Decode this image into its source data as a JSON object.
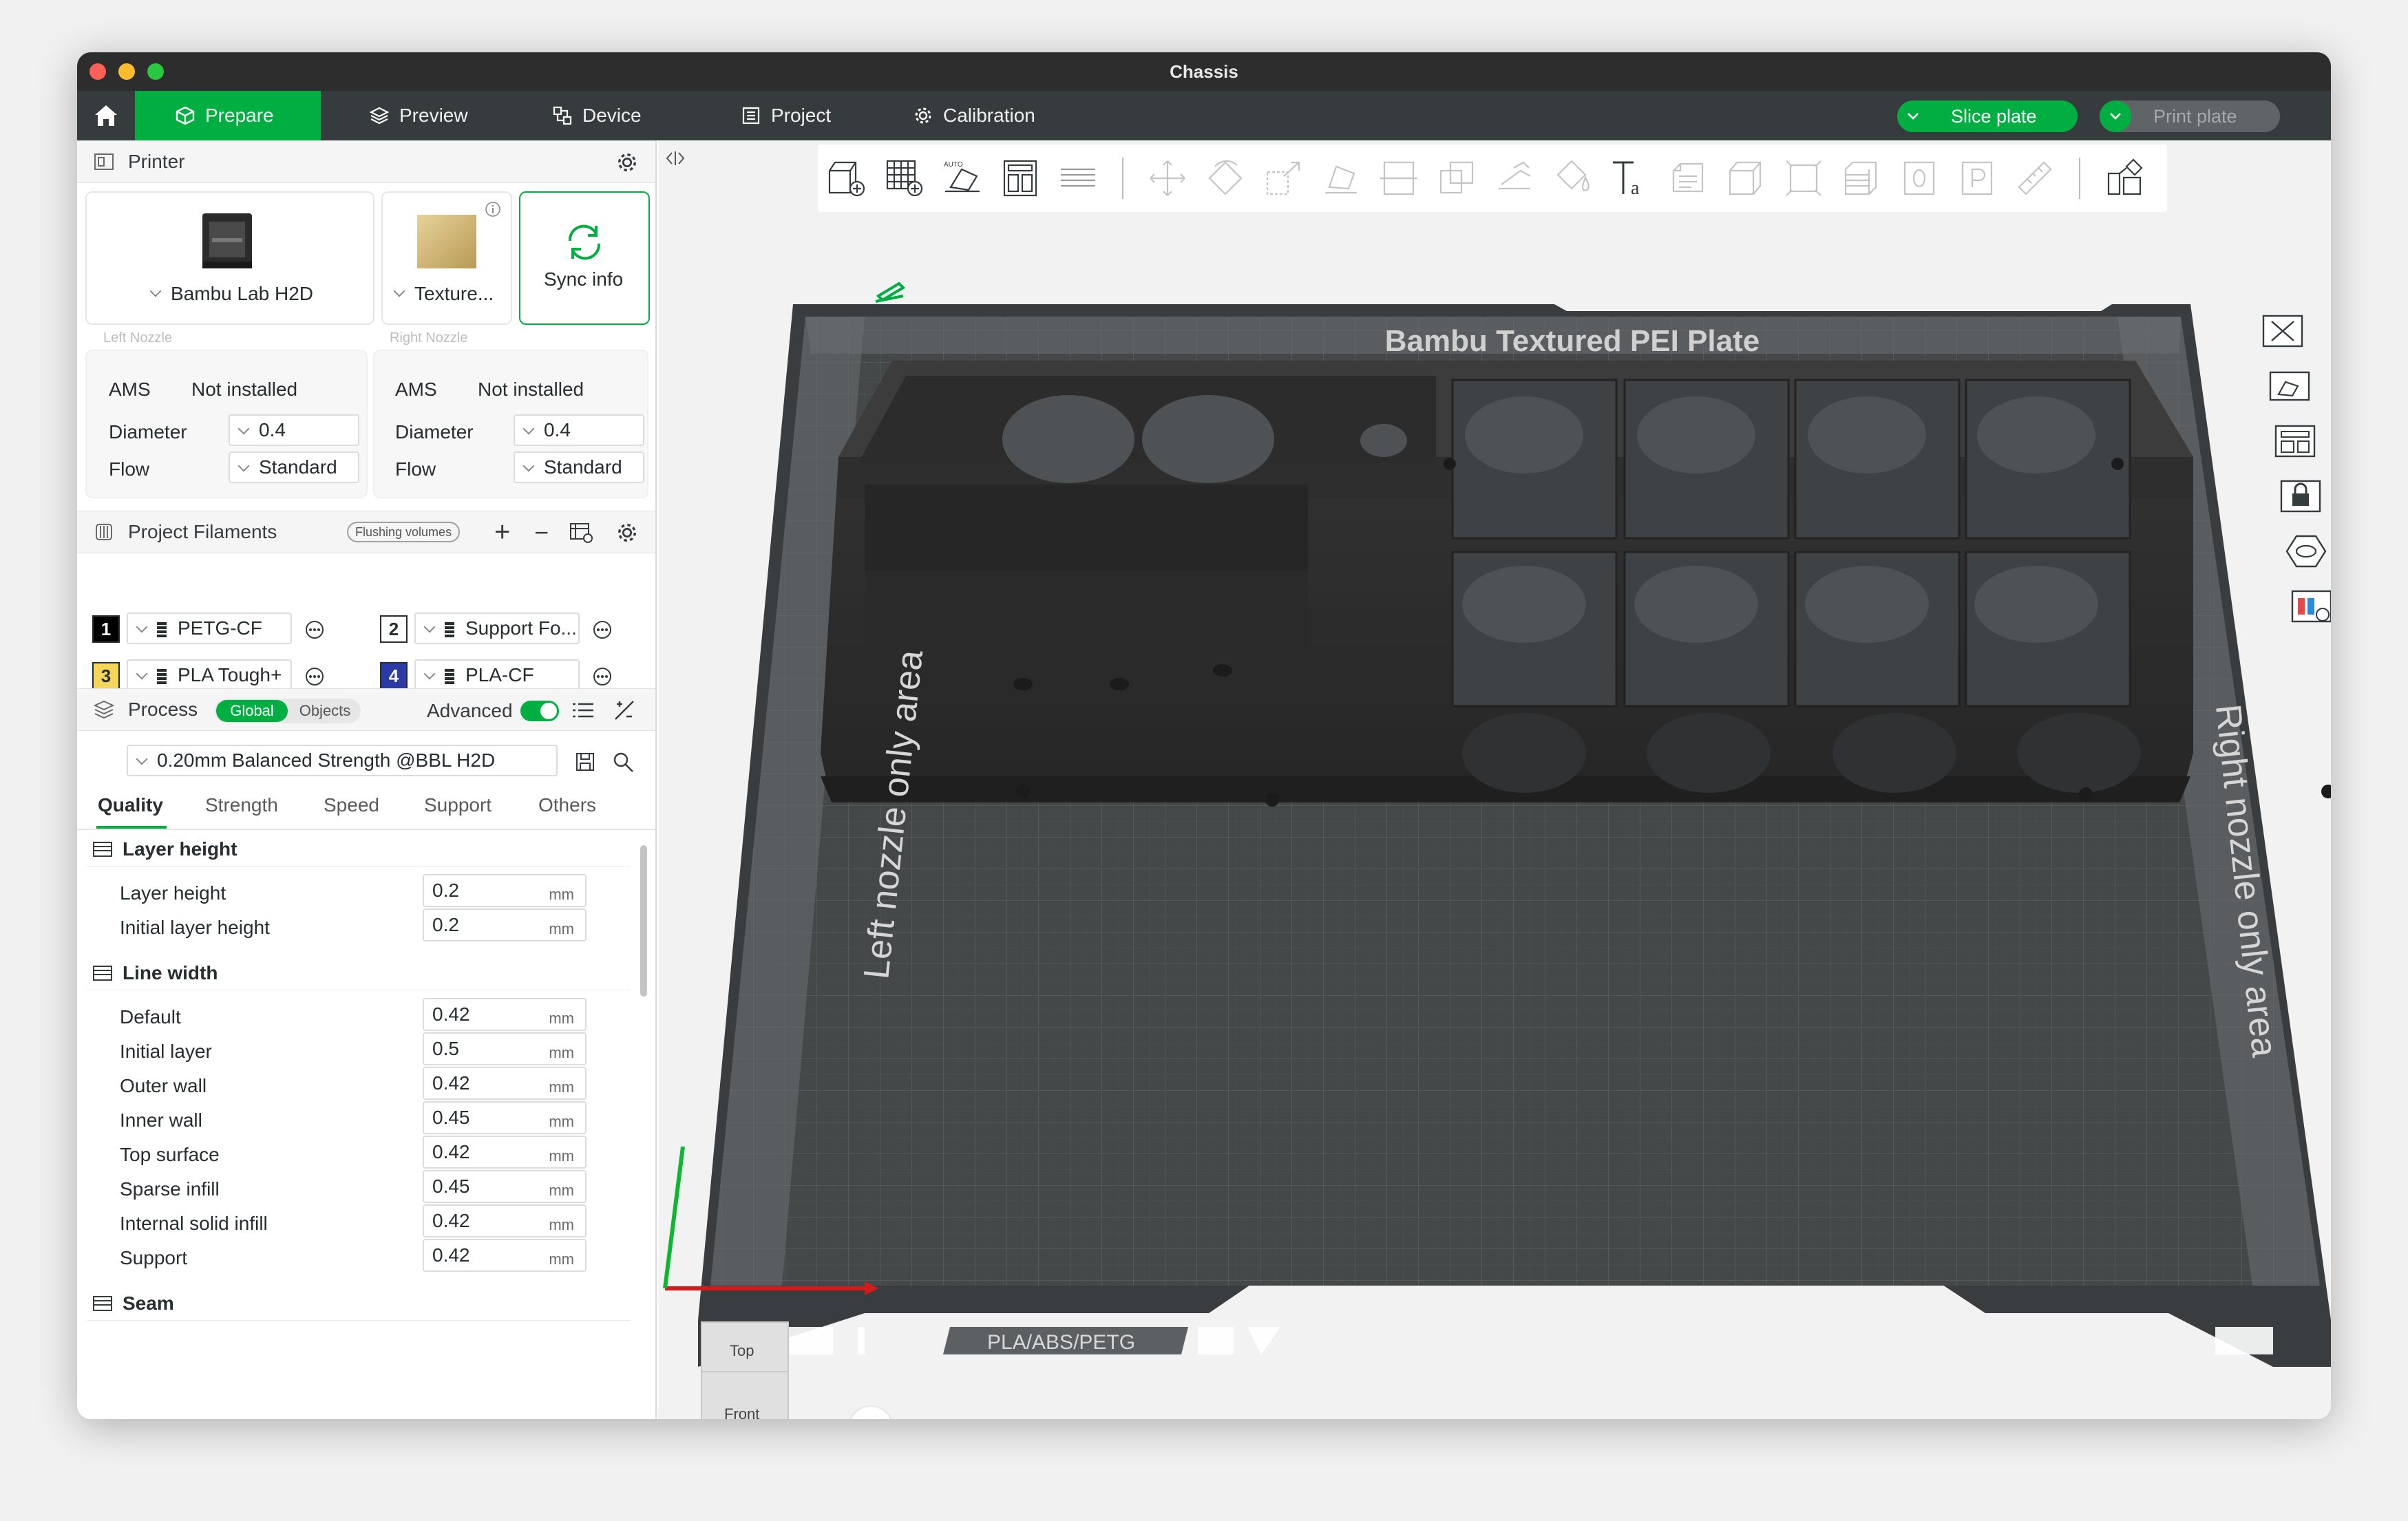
{
  "window": {
    "title": "Chassis"
  },
  "menu": {
    "tabs": [
      {
        "label": "Prepare",
        "icon": "cube-icon"
      },
      {
        "label": "Preview",
        "icon": "layers-icon"
      },
      {
        "label": "Device",
        "icon": "device-icon"
      },
      {
        "label": "Project",
        "icon": "project-icon"
      },
      {
        "label": "Calibration",
        "icon": "gear-icon"
      }
    ],
    "slice_label": "Slice plate",
    "print_label": "Print plate",
    "accent": "#00ae42"
  },
  "printer": {
    "title": "Printer",
    "model": "Bambu Lab H2D",
    "plate": "Texture...",
    "sync_label": "Sync info",
    "left_nozzle": {
      "heading": "Left Nozzle",
      "ams_label": "AMS",
      "ams_value": "Not installed",
      "diameter_label": "Diameter",
      "diameter": "0.4",
      "flow_label": "Flow",
      "flow": "Standard"
    },
    "right_nozzle": {
      "heading": "Right Nozzle",
      "ams_label": "AMS",
      "ams_value": "Not installed",
      "diameter_label": "Diameter",
      "diameter": "0.4",
      "flow_label": "Flow",
      "flow": "Standard"
    }
  },
  "filaments": {
    "title": "Project Filaments",
    "flushing_label": "Flushing volumes",
    "items": [
      {
        "num": "1",
        "name": "PETG-CF",
        "color": "#000000",
        "text_color": "#ffffff"
      },
      {
        "num": "2",
        "name": "Support Fo...",
        "color": "#ffffff",
        "text_color": "#262e30"
      },
      {
        "num": "3",
        "name": "PLA Tough+",
        "color": "#f5d65b",
        "text_color": "#262e30"
      },
      {
        "num": "4",
        "name": "PLA-CF",
        "color": "#2b3aa5",
        "text_color": "#ffffff"
      }
    ]
  },
  "process": {
    "title": "Process",
    "toggle_global": "Global",
    "toggle_objects": "Objects",
    "advanced_label": "Advanced",
    "preset": "0.20mm Balanced Strength @BBL H2D",
    "tabs": [
      "Quality",
      "Strength",
      "Speed",
      "Support",
      "Others"
    ],
    "groups": [
      {
        "title": "Layer height",
        "params": [
          {
            "name": "Layer height",
            "value": "0.2",
            "unit": "mm"
          },
          {
            "name": "Initial layer height",
            "value": "0.2",
            "unit": "mm"
          }
        ]
      },
      {
        "title": "Line width",
        "params": [
          {
            "name": "Default",
            "value": "0.42",
            "unit": "mm"
          },
          {
            "name": "Initial layer",
            "value": "0.5",
            "unit": "mm"
          },
          {
            "name": "Outer wall",
            "value": "0.42",
            "unit": "mm"
          },
          {
            "name": "Inner wall",
            "value": "0.45",
            "unit": "mm"
          },
          {
            "name": "Top surface",
            "value": "0.42",
            "unit": "mm"
          },
          {
            "name": "Sparse infill",
            "value": "0.45",
            "unit": "mm"
          },
          {
            "name": "Internal solid infill",
            "value": "0.42",
            "unit": "mm"
          },
          {
            "name": "Support",
            "value": "0.42",
            "unit": "mm"
          }
        ]
      },
      {
        "title": "Seam",
        "params": []
      }
    ]
  },
  "plate": {
    "title": "Bambu Textured PEI Plate",
    "left_area": "Left nozzle only area",
    "right_area": "Right nozzle only area",
    "material_label": "PLA/ABS/PETG"
  },
  "view_cube": {
    "top": "Top",
    "front": "Front",
    "axis_x": "x"
  }
}
